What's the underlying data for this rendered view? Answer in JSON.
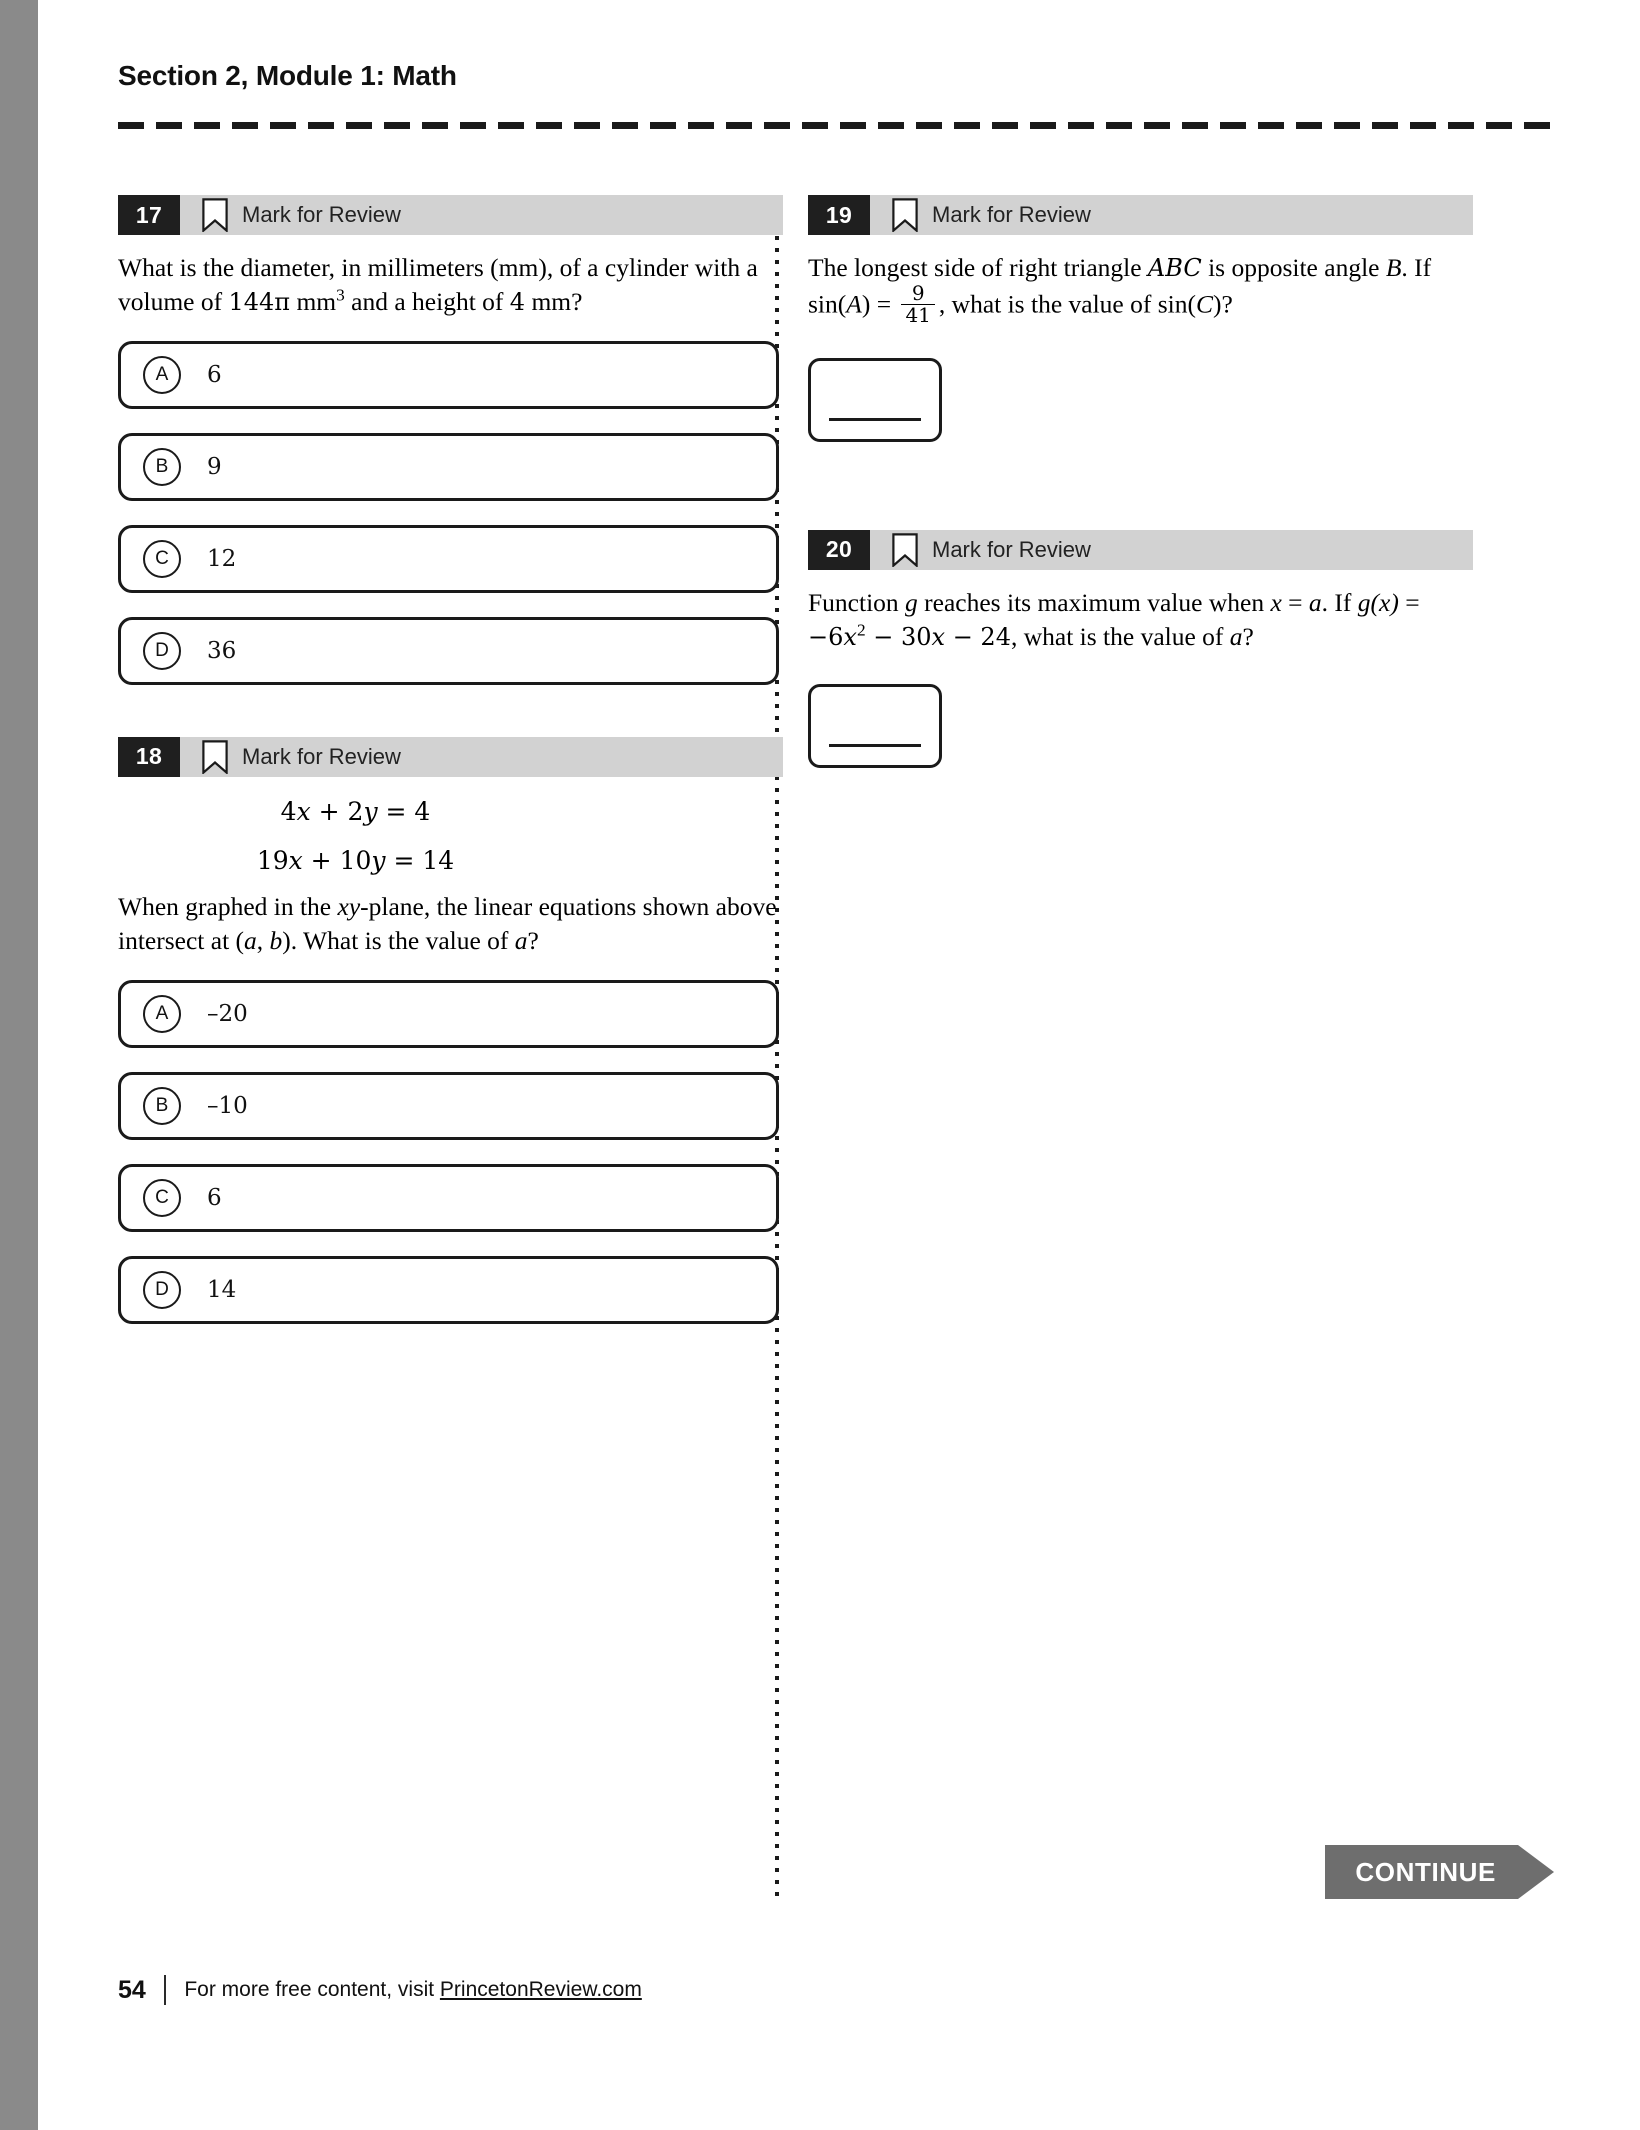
{
  "header": {
    "title": "Section 2, Module 1: Math"
  },
  "mark_for_review_label": "Mark for Review",
  "questions": {
    "q17": {
      "number": "17",
      "prompt_part1": "What is the diameter, in millimeters (mm), of a cylinder with a volume of ",
      "prompt_math1": "144π",
      "prompt_part2": " mm",
      "prompt_sup": "3",
      "prompt_part3": " and a height of ",
      "prompt_math2": "4",
      "prompt_part4": " mm?",
      "choices": [
        {
          "letter": "A",
          "text": "6"
        },
        {
          "letter": "B",
          "text": "9"
        },
        {
          "letter": "C",
          "text": "12"
        },
        {
          "letter": "D",
          "text": "36"
        }
      ]
    },
    "q18": {
      "number": "18",
      "equations": [
        {
          "lhs_a": "4",
          "var_x": "x",
          "plus": " + ",
          "lhs_b": "2",
          "var_y": "y",
          "eq": " = ",
          "rhs": "4"
        },
        {
          "lhs_a": "19",
          "var_x": "x",
          "plus": " + ",
          "lhs_b": "10",
          "var_y": "y",
          "eq": " = ",
          "rhs": "14"
        }
      ],
      "prompt_part1": "When graphed in the ",
      "prompt_xy": "xy",
      "prompt_part2": "-plane, the linear equations shown above intersect at (",
      "prompt_a": "a",
      "prompt_comma": ", ",
      "prompt_b": "b",
      "prompt_part3": "). What is the value of ",
      "prompt_a2": "a",
      "prompt_part4": "?",
      "choices": [
        {
          "letter": "A",
          "text": "–20"
        },
        {
          "letter": "B",
          "text": "–10"
        },
        {
          "letter": "C",
          "text": "6"
        },
        {
          "letter": "D",
          "text": "14"
        }
      ]
    },
    "q19": {
      "number": "19",
      "prompt_part1": "The longest side of right triangle ",
      "prompt_abc": "ABC",
      "prompt_part2": " is opposite angle ",
      "prompt_b": "B",
      "prompt_part3": ". If sin(",
      "prompt_a": "A",
      "prompt_part4": ") = ",
      "frac_num": "9",
      "frac_den": "41",
      "prompt_part5": ", what is the value of sin(",
      "prompt_c": "C",
      "prompt_part6": ")?",
      "answer_value": ""
    },
    "q20": {
      "number": "20",
      "prompt_part1": "Function ",
      "prompt_g": "g",
      "prompt_part2": " reaches its maximum value when ",
      "prompt_x": "x",
      "prompt_eq": " = ",
      "prompt_a": "a",
      "prompt_part3": ". If ",
      "prompt_gx": "g",
      "prompt_paren_x": "(x)",
      "prompt_eq2": " = ",
      "prompt_expr1": "−6",
      "prompt_expr_x": "x",
      "prompt_expr_sup": "2",
      "prompt_expr2": " − 30",
      "prompt_expr_x2": "x",
      "prompt_expr3": " − 24",
      "prompt_part4": ", what is the value of ",
      "prompt_a2": "a",
      "prompt_part5": "?",
      "answer_value": ""
    }
  },
  "continue_button": {
    "label": "CONTINUE"
  },
  "footer": {
    "page_number": "54",
    "text": "For more free content, visit ",
    "link": "PrincetonReview.com"
  },
  "colors": {
    "spine": "#8a8a8a",
    "qhead_bg": "#d2d2d2",
    "qnum_bg": "#1f1f1f",
    "continue_bg": "#6e6e6e",
    "ink": "#111111"
  }
}
